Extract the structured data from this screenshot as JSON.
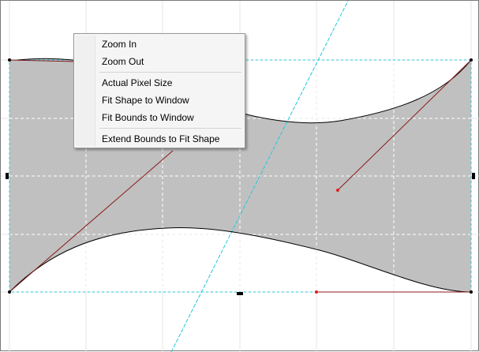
{
  "colors": {
    "shape_fill": "#c0c0c0",
    "grid_line": "#e6e6e6",
    "guide_line": "#20c8e0",
    "curve": "#000000",
    "tangent": "#8b1a1a",
    "tangent_point": "#e02020",
    "handle": "#000000"
  },
  "context_menu": {
    "groups": [
      [
        "Zoom In",
        "Zoom Out"
      ],
      [
        "Actual Pixel Size",
        "Fit Shape to Window",
        "Fit Bounds to Window"
      ],
      [
        "Extend Bounds to Fit Shape"
      ]
    ]
  }
}
